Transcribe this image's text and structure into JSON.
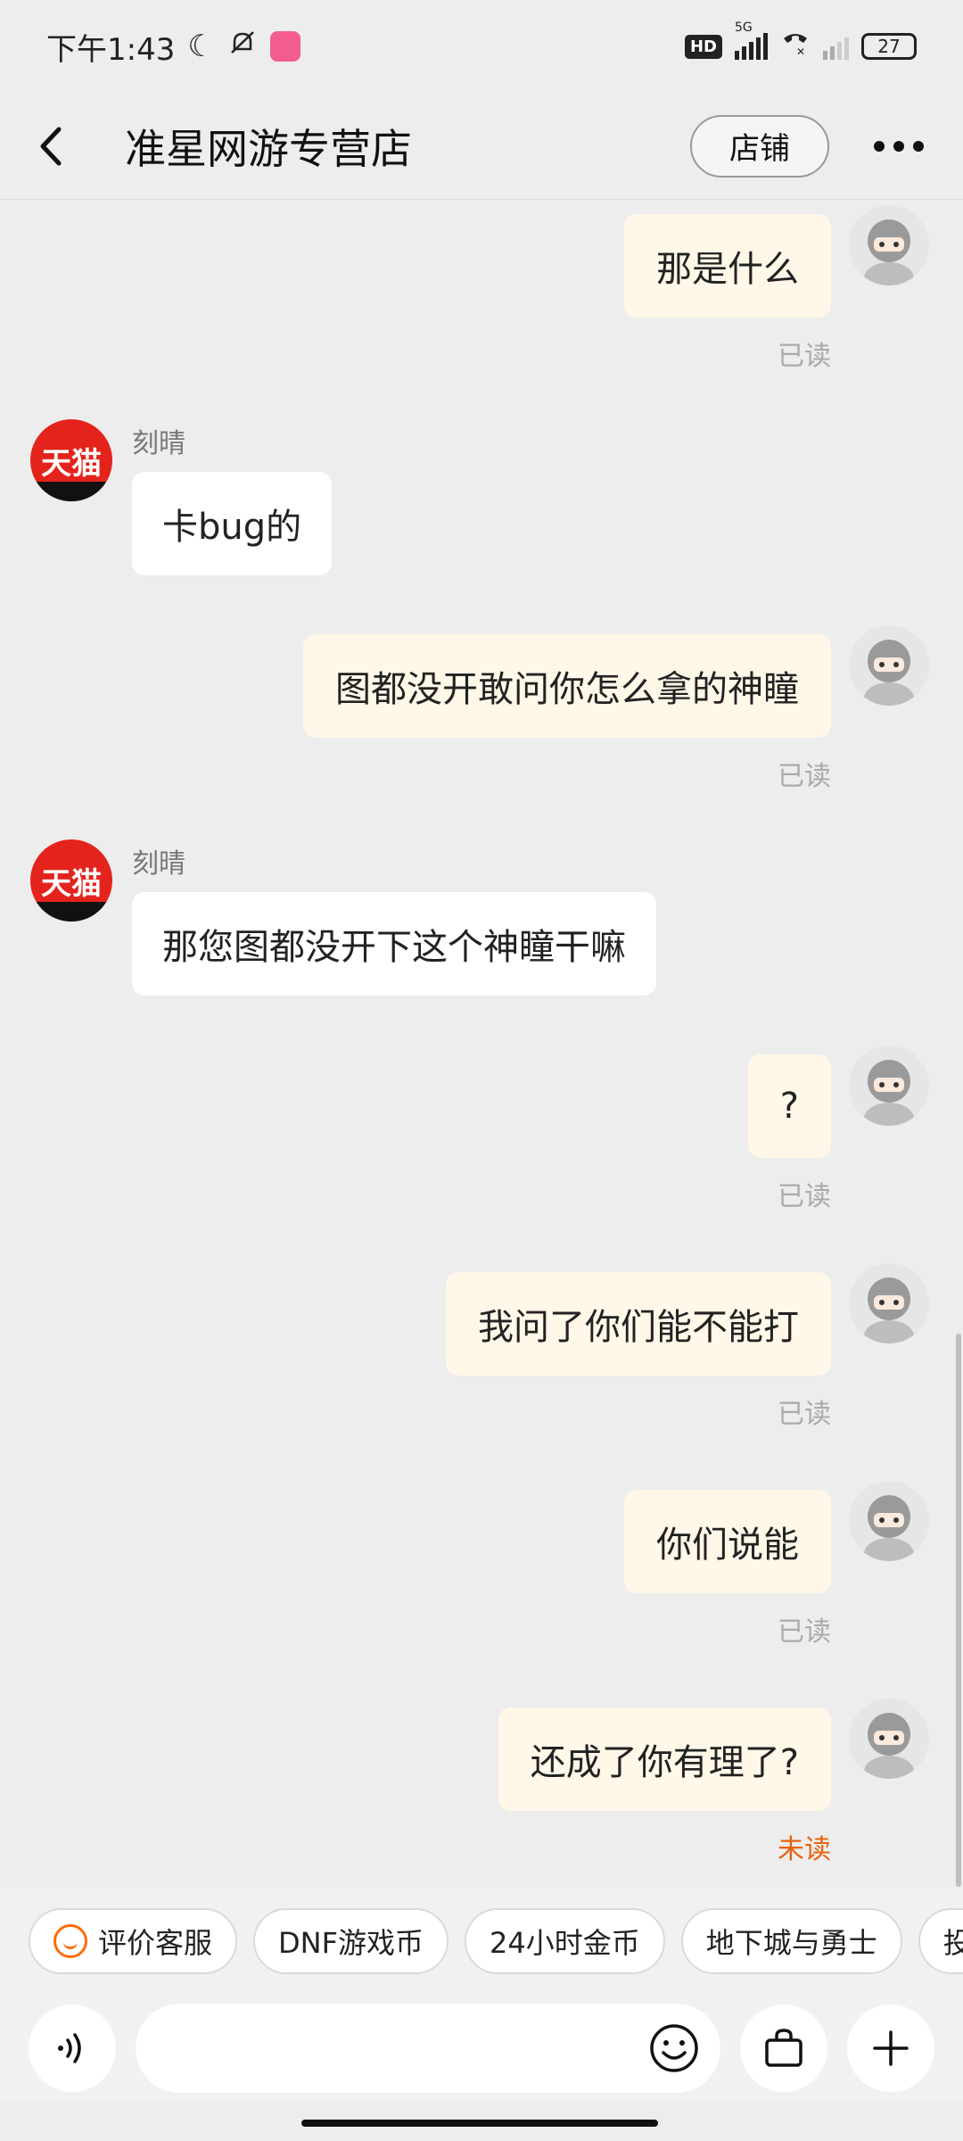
{
  "status_bar": {
    "time": "下午1:43",
    "network": "5G",
    "hd": "HD",
    "battery": "27"
  },
  "header": {
    "title": "准星网游专营店",
    "shop_button": "店铺"
  },
  "messages": [
    {
      "from": "me",
      "text": "那是什么",
      "status": "已读"
    },
    {
      "from": "shop",
      "sender": "刻晴",
      "avatar_text": "天猫",
      "text": "卡bug的"
    },
    {
      "from": "me",
      "text": "图都没开敢问你怎么拿的神瞳",
      "status": "已读"
    },
    {
      "from": "shop",
      "sender": "刻晴",
      "avatar_text": "天猫",
      "text": "那您图都没开下这个神瞳干嘛"
    },
    {
      "from": "me",
      "text": "?",
      "status": "已读"
    },
    {
      "from": "me",
      "text": "我问了你们能不能打",
      "status": "已读"
    },
    {
      "from": "me",
      "text": "你们说能",
      "status": "已读"
    },
    {
      "from": "me",
      "text": "还成了你有理了?",
      "status": "未读"
    }
  ],
  "quick_chips": [
    "评价客服",
    "DNF游戏币",
    "24小时金币",
    "地下城与勇士",
    "投诉"
  ],
  "colors": {
    "accent": "#ff6a00",
    "unread": "#e8620c",
    "bubble_me": "#fff7e8",
    "tmall_red": "#e4231c"
  }
}
